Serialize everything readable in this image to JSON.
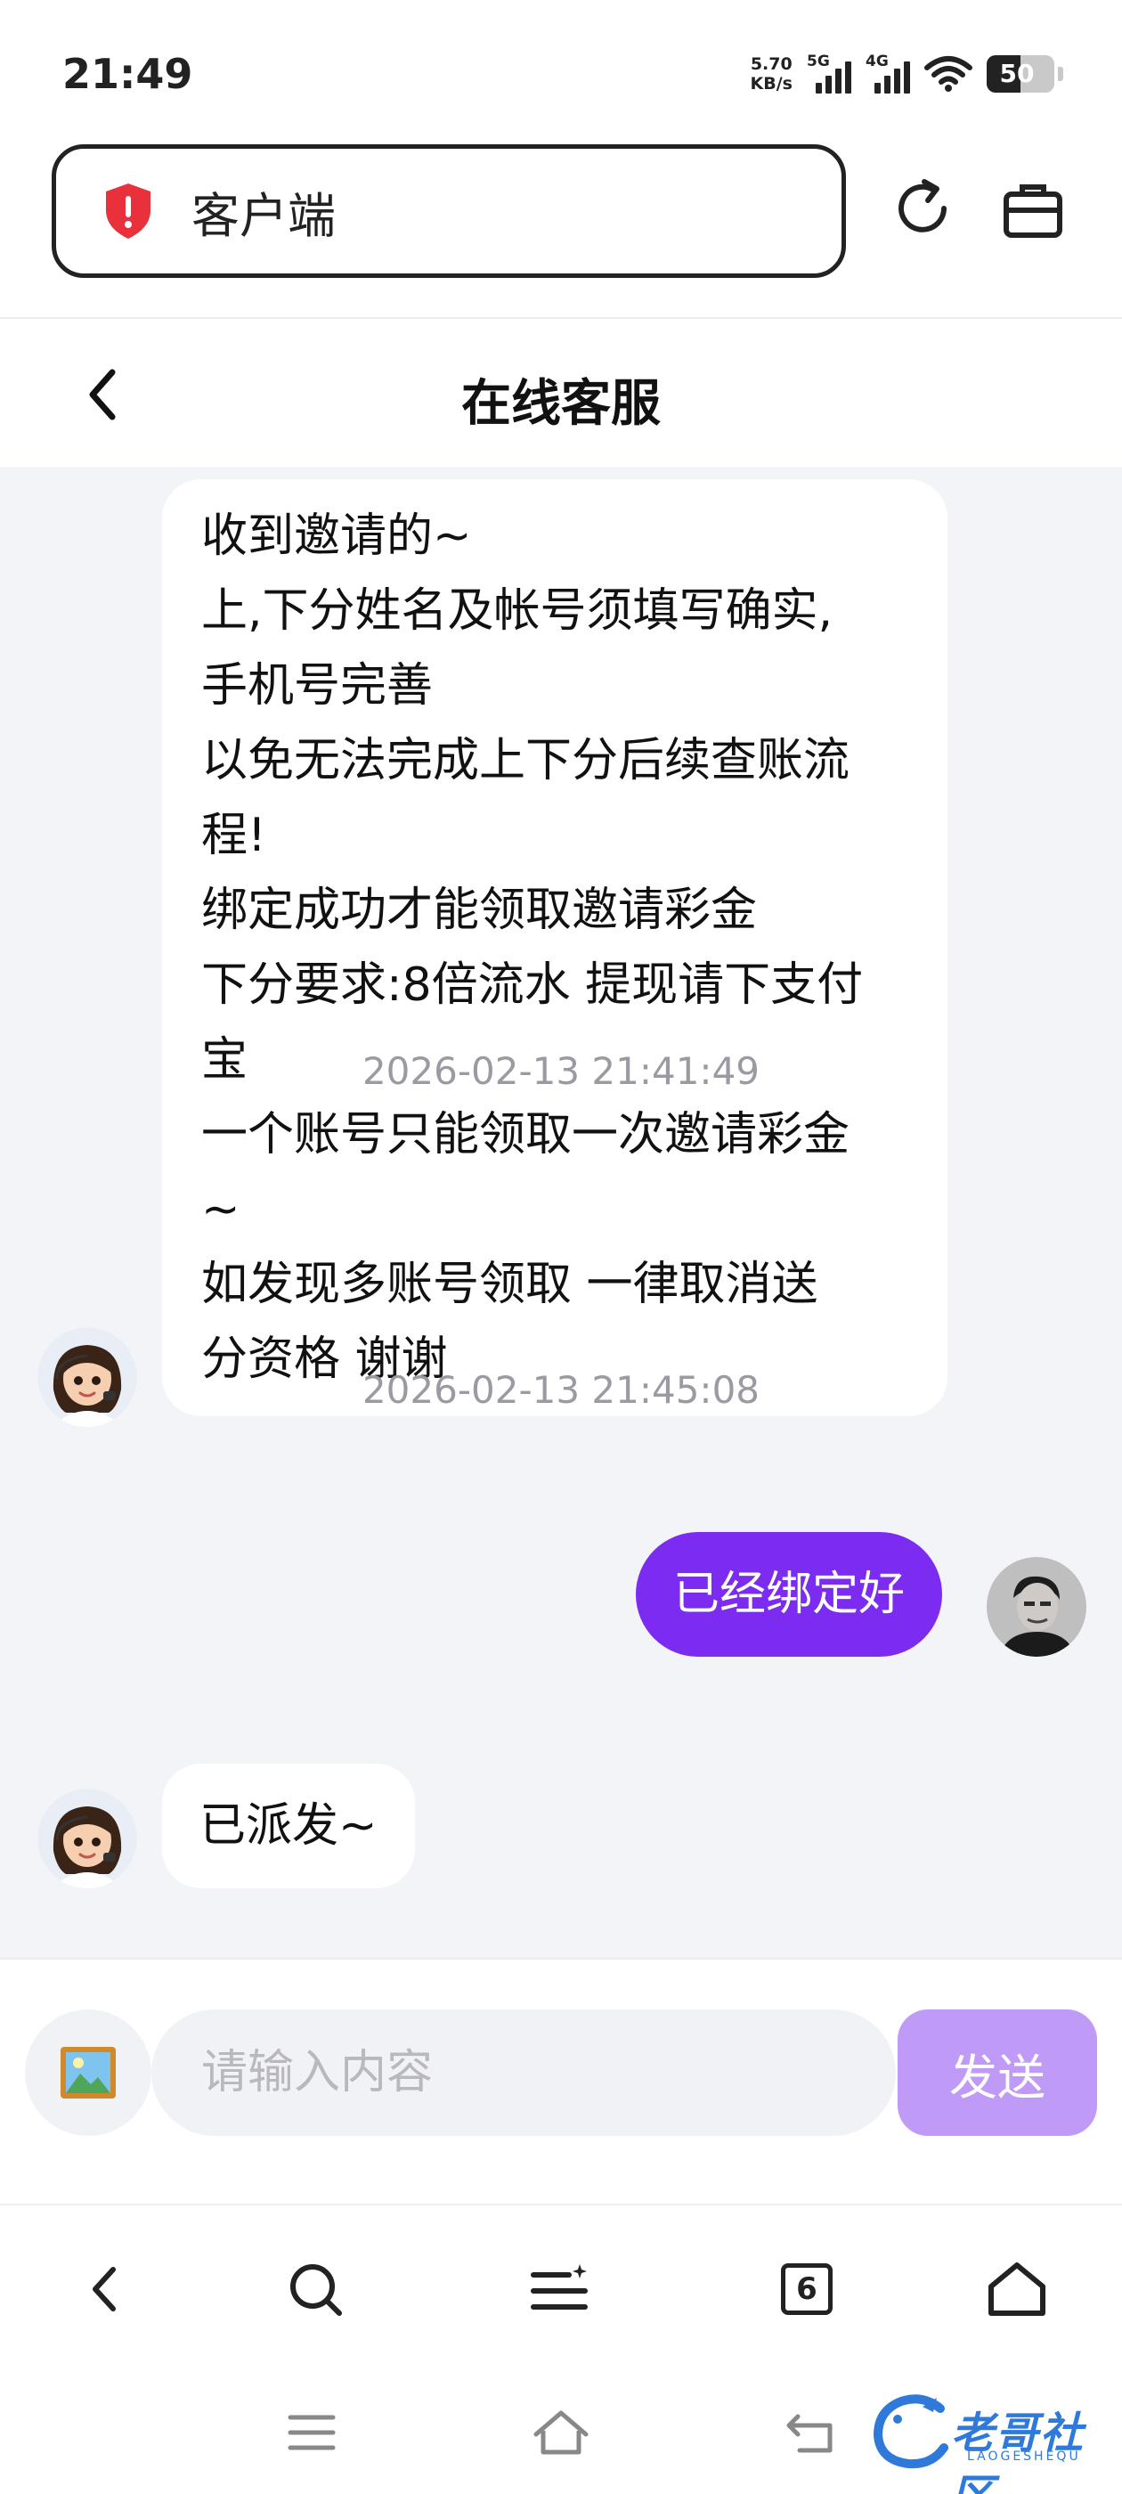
{
  "status_bar": {
    "time": "21:49",
    "net_speed_value": "5.70",
    "net_speed_unit": "KB/s",
    "signal_1_label": "5G",
    "signal_2_label": "4G",
    "battery": "50",
    "battery_level": 0.5
  },
  "browser": {
    "address_text": "客户端",
    "icons": [
      "shield-alert-icon",
      "reload-icon",
      "briefcase-icon"
    ]
  },
  "page": {
    "title": "在线客服"
  },
  "chat": {
    "messages": [
      {
        "sender": "agent",
        "lines": [
          "收到邀请的~",
          "上,下分姓名及帐号须填写确实,",
          "手机号完善",
          "以免无法完成上下分后续查账流",
          "程!",
          "绑定成功才能领取邀请彩金",
          "下分要求:8倍流水 提现请下支付",
          "宝",
          "一个账号只能领取一次邀请彩金",
          "~",
          "如发现多账号领取 一律取消送",
          "分资格 谢谢"
        ]
      },
      {
        "sender": "timestamp",
        "text": "2026-02-13 21:41:49"
      },
      {
        "sender": "user",
        "text": "已经绑定好"
      },
      {
        "sender": "timestamp",
        "text": "2026-02-13 21:45:08"
      },
      {
        "sender": "agent",
        "text": "已派发~"
      }
    ]
  },
  "composer": {
    "placeholder": "请输入内容",
    "send_label": "发送",
    "image_icon": "picture-icon"
  },
  "toolbar": {
    "tab_count": "6",
    "icons": [
      "back-icon",
      "search-icon",
      "menu-icon",
      "tabs-icon",
      "home-icon"
    ]
  },
  "system_nav": {
    "icons": [
      "recents-icon",
      "home-icon",
      "back-icon"
    ],
    "watermark_text": "老哥社区",
    "watermark_sub": "LAOGESHEQU"
  },
  "colors": {
    "accent": "#7b2cf0",
    "send_button": "#c09af7",
    "chat_background": "#f3f4f8",
    "timestamp": "#9a9aa2",
    "shield": "#e8313a"
  }
}
